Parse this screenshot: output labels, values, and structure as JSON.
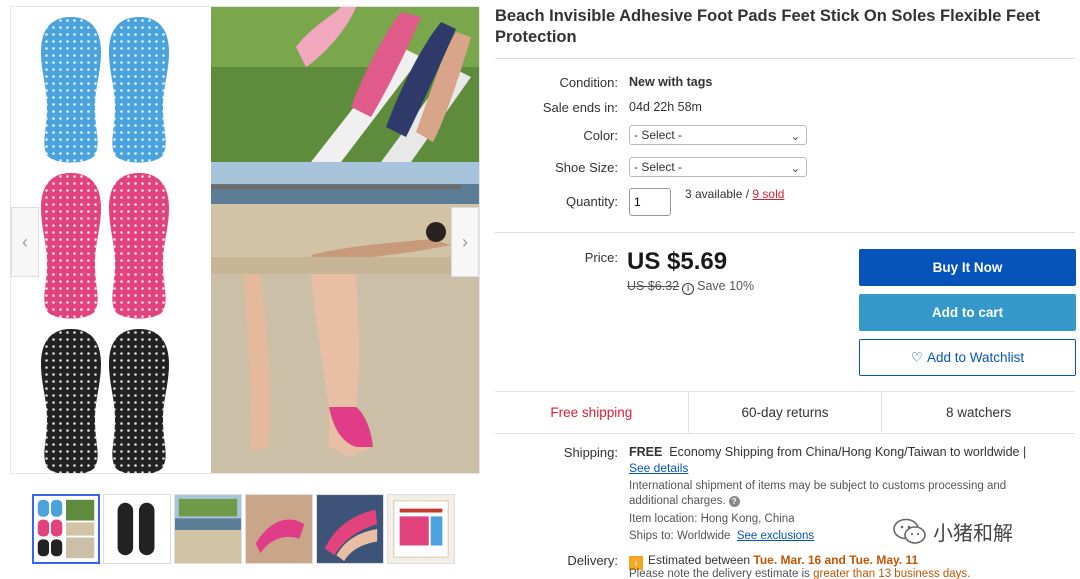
{
  "product": {
    "title": "Beach Invisible Adhesive Foot Pads Feet Stick On Soles Flexible Feet Protection"
  },
  "details": {
    "condition_label": "Condition:",
    "condition_value": "New with tags",
    "sale_ends_label": "Sale ends in:",
    "sale_ends_value": "04d 22h 58m",
    "color_label": "Color:",
    "color_select": "- Select -",
    "size_label": "Shoe Size:",
    "size_select": "- Select -",
    "quantity_label": "Quantity:",
    "quantity_value": "1",
    "available_text": "3 available /",
    "sold_text": "9 sold"
  },
  "pricing": {
    "price_label": "Price:",
    "price": "US $5.69",
    "was_price": "US $6.32",
    "save_text": "Save 10%"
  },
  "actions": {
    "buy_now": "Buy It Now",
    "add_to_cart": "Add to cart",
    "watchlist": "Add to Watchlist"
  },
  "highlights": {
    "free_shipping": "Free shipping",
    "returns": "60-day returns",
    "watchers": "8 watchers"
  },
  "shipping": {
    "label": "Shipping:",
    "free": "FREE",
    "text": "Economy Shipping from China/Hong Kong/Taiwan to worldwide |",
    "see_details": "See details",
    "note": "International shipment of items may be subject to customs processing and additional charges.",
    "item_location_label": "Item location:",
    "item_location": "Hong Kong, China",
    "ships_to_label": "Ships to:",
    "ships_to": "Worldwide",
    "see_exclusions": "See exclusions"
  },
  "delivery": {
    "label": "Delivery:",
    "estimated_prefix": "Estimated between",
    "estimated_range": "Tue. Mar. 16 and Tue. May. 11",
    "note_prefix": "Please note the delivery estimate is",
    "note_highlight": "greater than 13 business days."
  },
  "watermark": {
    "text": "小猪和解"
  },
  "colors": {
    "accent_blue": "#0654ba",
    "cart_blue": "#3498ca",
    "red": "#dd1e31",
    "pad_blue": "#4aa3dc",
    "pad_pink": "#e2437c",
    "pad_black": "#222222"
  }
}
